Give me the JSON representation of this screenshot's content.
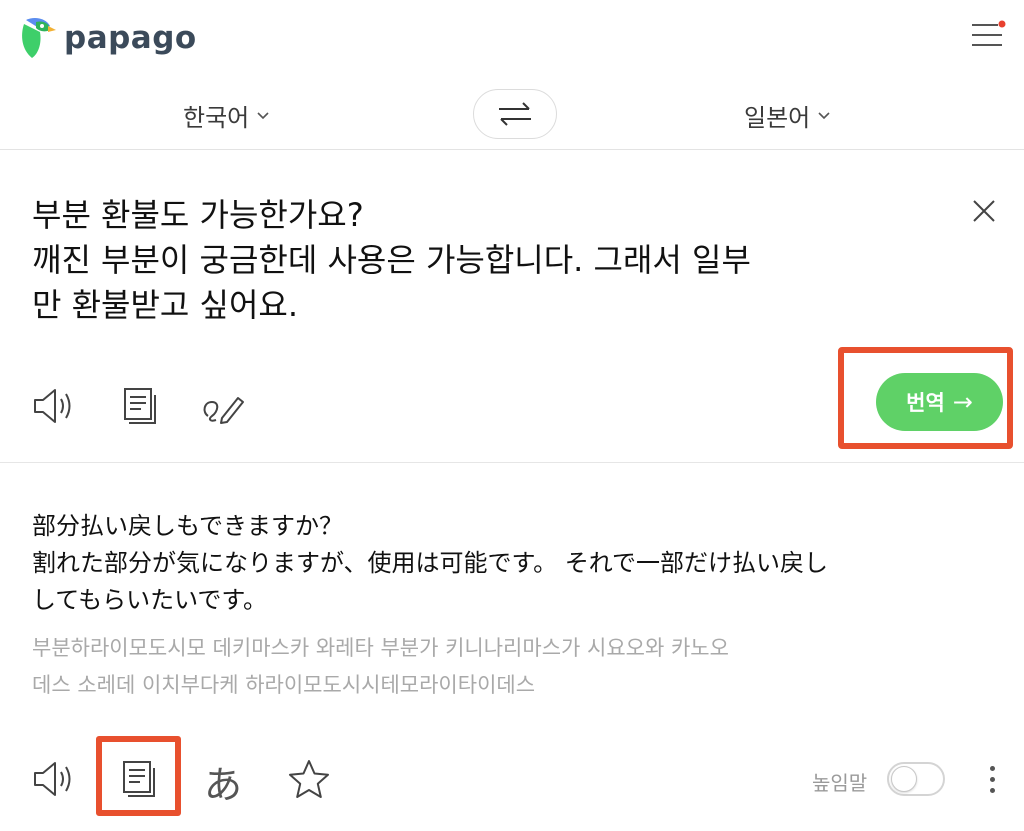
{
  "app": {
    "logo_text": "papago"
  },
  "header": {
    "menu_icon": "hamburger-menu-icon",
    "notification_dot_color": "#e8402e"
  },
  "languages": {
    "source": "한국어",
    "target": "일본어",
    "swap_icon": "swap-arrows-icon"
  },
  "source": {
    "text": "부분 환불도 가능한가요?\n깨진 부분이 궁금한데 사용은 가능합니다. 그래서 일부\n만 환불받고 싶어요.",
    "clear_icon": "close-icon",
    "tools": [
      "speaker-icon",
      "copy-icon",
      "handwriting-icon"
    ],
    "translate_label": "번역",
    "translate_color": "#5fd167"
  },
  "result": {
    "text": "部分払い戻しもできますか？\n割れた部分が気になりますが、使用は可能です。 それで一部だけ払い戻し\nしてもらいたいです。",
    "pronunciation": "부분하라이모도시모 데키마스카 와레타 부분가 키니나리마스가 시요오와 카노오\n데스 소레데 이치부다케 하라이모도시시테모라이타이데스",
    "hiragana_label": "あ",
    "honorific_label": "높임말",
    "honorific_on": false,
    "tools": [
      "speaker-icon",
      "copy-icon",
      "hiragana-icon",
      "star-icon",
      "more-vertical-icon"
    ]
  },
  "highlight_color": "#e8502e"
}
